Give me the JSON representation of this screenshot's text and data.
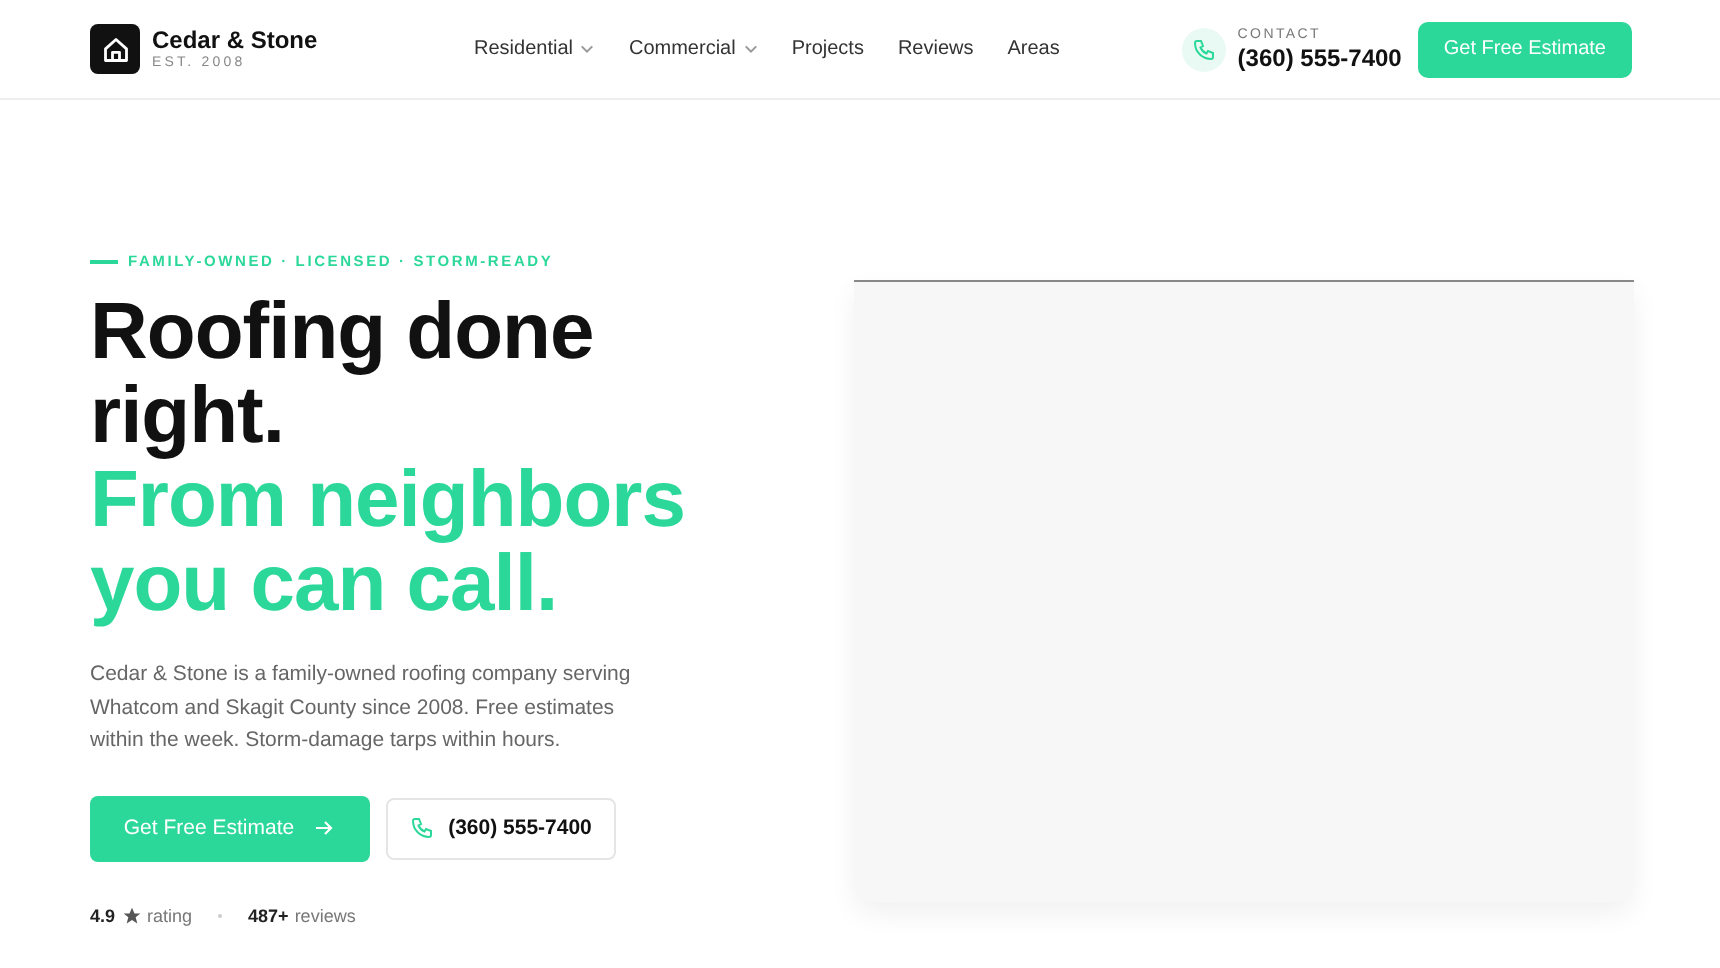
{
  "brand": {
    "name": "Cedar & Stone",
    "tagline": "EST. 2008"
  },
  "nav": [
    {
      "label": "Residential",
      "has_menu": true
    },
    {
      "label": "Commercial",
      "has_menu": true
    },
    {
      "label": "Projects",
      "has_menu": false
    },
    {
      "label": "Reviews",
      "has_menu": false
    },
    {
      "label": "Areas",
      "has_menu": false
    }
  ],
  "contact": {
    "label": "CONTACT",
    "phone": "(360) 555-7400"
  },
  "header_cta": "Get Free Estimate",
  "hero": {
    "eyebrow": "FAMILY-OWNED · LICENSED · STORM-READY",
    "headline": "Roofing done right.",
    "headline_accent": "From neighbors you can call.",
    "body": "Cedar & Stone is a family-owned roofing company serving Whatcom and Skagit County since 2008. Free estimates within the week. Storm-damage tarps within hours.",
    "primary_button": "Get Free Estimate",
    "phone_button": "(360) 555-7400",
    "stats": [
      {
        "value": "4.9",
        "label": "rating",
        "star": true
      },
      {
        "value": "487+",
        "label": "reviews",
        "star": false
      }
    ]
  }
}
